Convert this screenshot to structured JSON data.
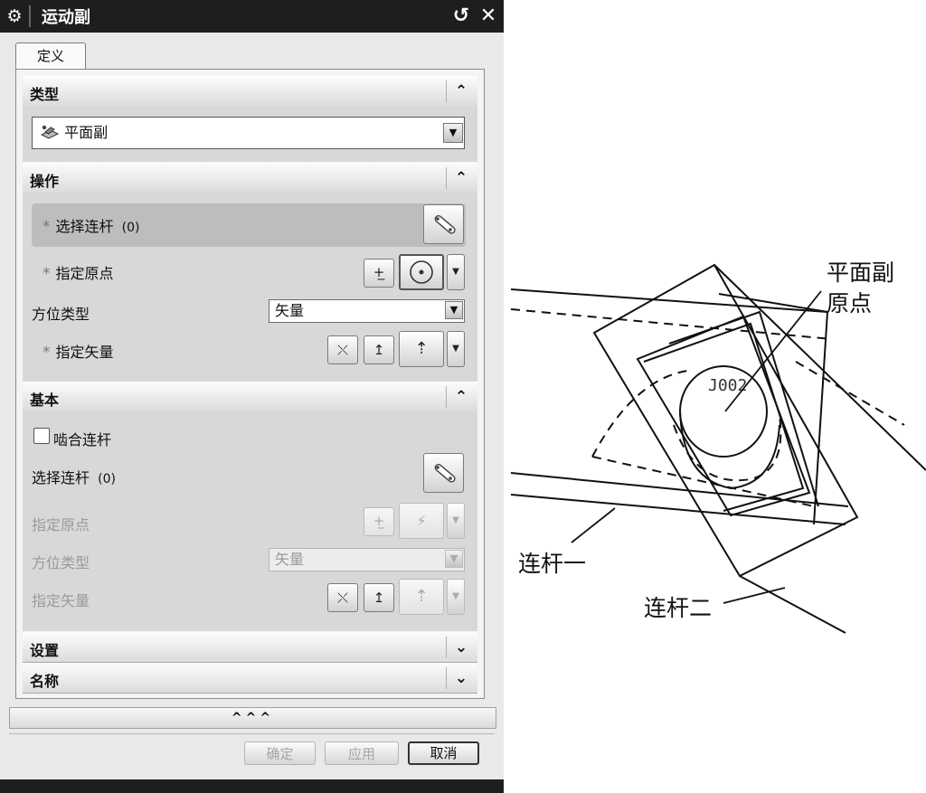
{
  "dialog": {
    "title": "运动副",
    "icons": {
      "settings": "gear-icon",
      "reset": "reset-icon",
      "close": "close-icon"
    },
    "tab": "定义",
    "type_section": {
      "label": "类型",
      "selected": "平面副"
    },
    "operation_section": {
      "label": "操作",
      "select_link": "选择连杆",
      "select_link_count": "(0)",
      "specify_origin": "指定原点",
      "orientation_type_label": "方位类型",
      "orientation_type_value": "矢量",
      "specify_vector": "指定矢量"
    },
    "base_section": {
      "label": "基本",
      "mesh_link": "啮合连杆",
      "mesh_link_checked": false,
      "select_link": "选择连杆",
      "select_link_count": "(0)",
      "specify_origin": "指定原点",
      "orientation_type_label": "方位类型",
      "orientation_type_value": "矢量",
      "specify_vector": "指定矢量"
    },
    "settings_section": {
      "label": "设置"
    },
    "name_section": {
      "label": "名称"
    },
    "more_label": "^^^",
    "buttons": {
      "ok": "确定",
      "apply": "应用",
      "cancel": "取消"
    }
  },
  "drawing": {
    "joint_label": "J002",
    "callouts": {
      "plane_joint_line1": "平面副",
      "plane_joint_line2": "原点",
      "link_one": "连杆一",
      "link_two": "连杆二"
    }
  }
}
